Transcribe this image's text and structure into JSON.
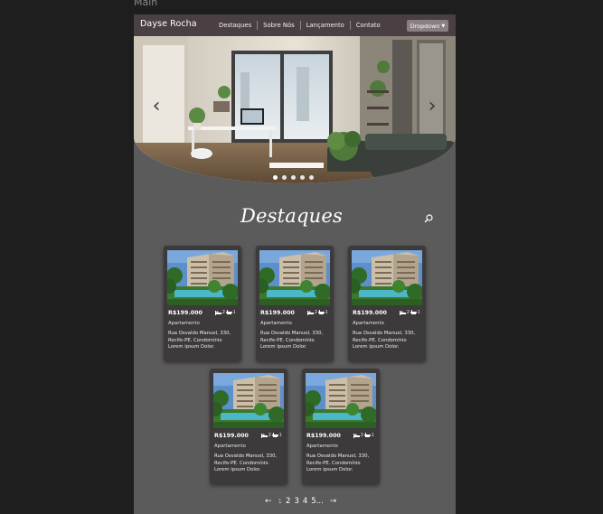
{
  "frame": {
    "label": "Main"
  },
  "navbar": {
    "brand": "Dayse Rocha",
    "links": [
      "Destaques",
      "Sobre Nós",
      "Lançamento",
      "Contato"
    ],
    "dropdown_label": "Dropdown"
  },
  "hero": {
    "prev_label": "‹",
    "next_label": "›",
    "slide_count": 5,
    "active_slide": 1
  },
  "section": {
    "title": "Destaques"
  },
  "cards": [
    {
      "price": "R$199.000",
      "beds": "2",
      "baths": "1",
      "type": "Apartamento",
      "address": "Rua Osvaldo Manuel, 330, Recife-PE. Condomínio Lorem ipsum Dolor."
    },
    {
      "price": "R$199.000",
      "beds": "2",
      "baths": "1",
      "type": "Apartamento",
      "address": "Rua Osvaldo Manuel, 330, Recife-PE. Condomínio Lorem ipsum Dolor."
    },
    {
      "price": "R$199.000",
      "beds": "2",
      "baths": "1",
      "type": "Apartamento",
      "address": "Rua Osvaldo Manuel, 330, Recife-PE. Condomínio Lorem ipsum Dolor."
    },
    {
      "price": "R$199.000",
      "beds": "2",
      "baths": "1",
      "type": "Apartamento",
      "address": "Rua Osvaldo Manuel, 330, Recife-PE. Condomínio Lorem ipsum Dolor."
    },
    {
      "price": "R$199.000",
      "beds": "2",
      "baths": "1",
      "type": "Apartamento",
      "address": "Rua Osvaldo Manuel, 330, Recife-PE. Condomínio Lorem ipsum Dolor."
    }
  ],
  "pagination": {
    "prev": "←",
    "pages": [
      "1",
      "2",
      "3",
      "4",
      "5..."
    ],
    "current": "1",
    "next": "→"
  },
  "colors": {
    "background": "#1e1e1e",
    "page": "#5c5b5c",
    "navbar": "#4a3f42",
    "card": "#3c3a3b"
  }
}
